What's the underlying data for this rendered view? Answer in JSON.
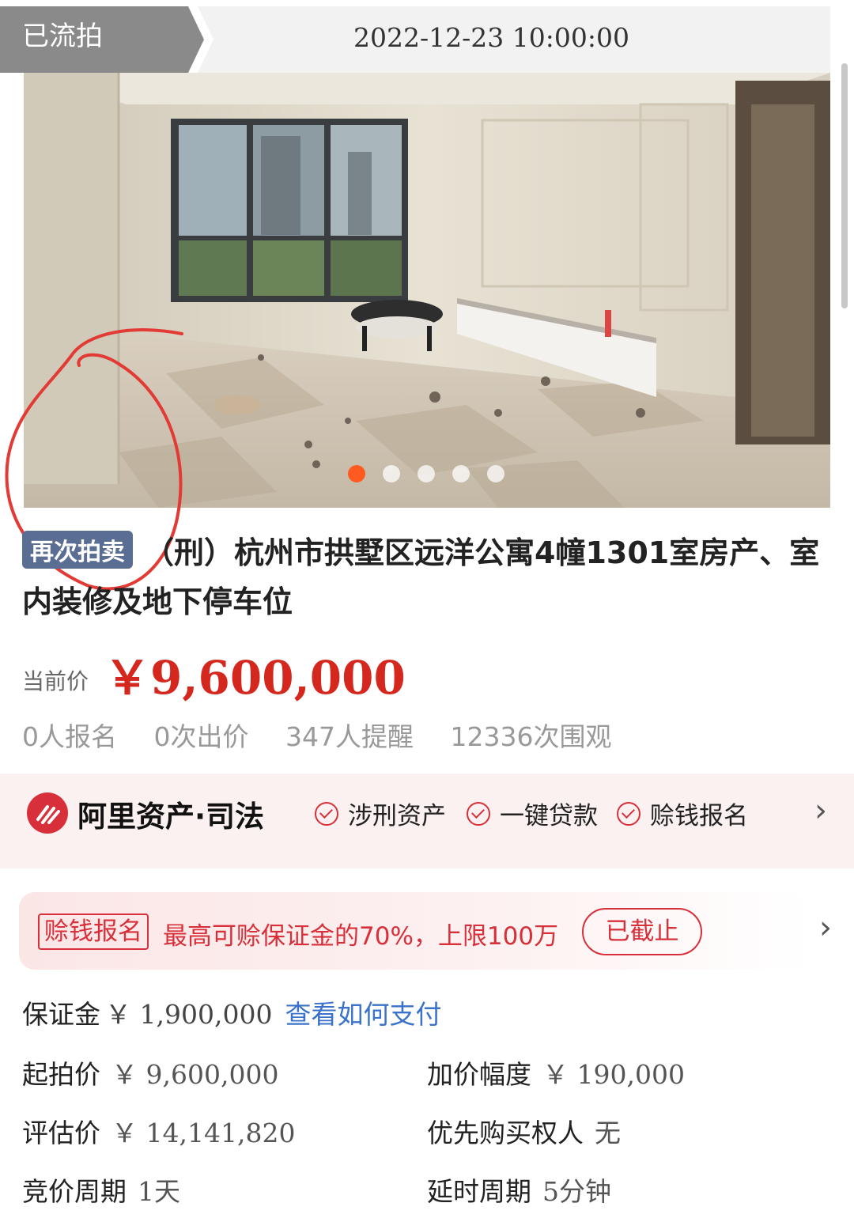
{
  "status": {
    "tag": "已流拍",
    "time": "2022-12-23 10:00:00"
  },
  "gallery": {
    "dot_count": 5,
    "active_index": 0
  },
  "title": {
    "tag": "再次拍卖",
    "text": "（刑）杭州市拱墅区远洋公寓4幢1301室房产、室内装修及地下停车位"
  },
  "price": {
    "label": "当前价",
    "value": "￥9,600,000"
  },
  "stats": [
    "0人报名",
    "0次出价",
    "347人提醒",
    "12336次围观"
  ],
  "brand": {
    "name": "阿里资产·司法",
    "features": [
      "涉刑资产",
      "一键贷款",
      "赊钱报名"
    ]
  },
  "bonus": {
    "tag": "赊钱报名",
    "text": "最高可赊保证金的70%，上限100万",
    "button": "已截止"
  },
  "deposit": {
    "label": "保证金",
    "value": "￥ 1,900,000",
    "link": "查看如何支付"
  },
  "info": {
    "start_price": {
      "label": "起拍价",
      "value": "￥ 9,600,000"
    },
    "increment": {
      "label": "加价幅度",
      "value": "￥ 190,000"
    },
    "appraisal": {
      "label": "评估价",
      "value": "￥ 14,141,820"
    },
    "priority": {
      "label": "优先购买权人",
      "value": "无"
    },
    "cycle": {
      "label": "竞价周期",
      "value": "1天"
    },
    "delay": {
      "label": "延时周期",
      "value": "5分钟"
    }
  },
  "colors": {
    "accent": "#d8303a",
    "price": "#d4281f",
    "link": "#3a73c9",
    "tag_blue": "#5a6e94"
  }
}
